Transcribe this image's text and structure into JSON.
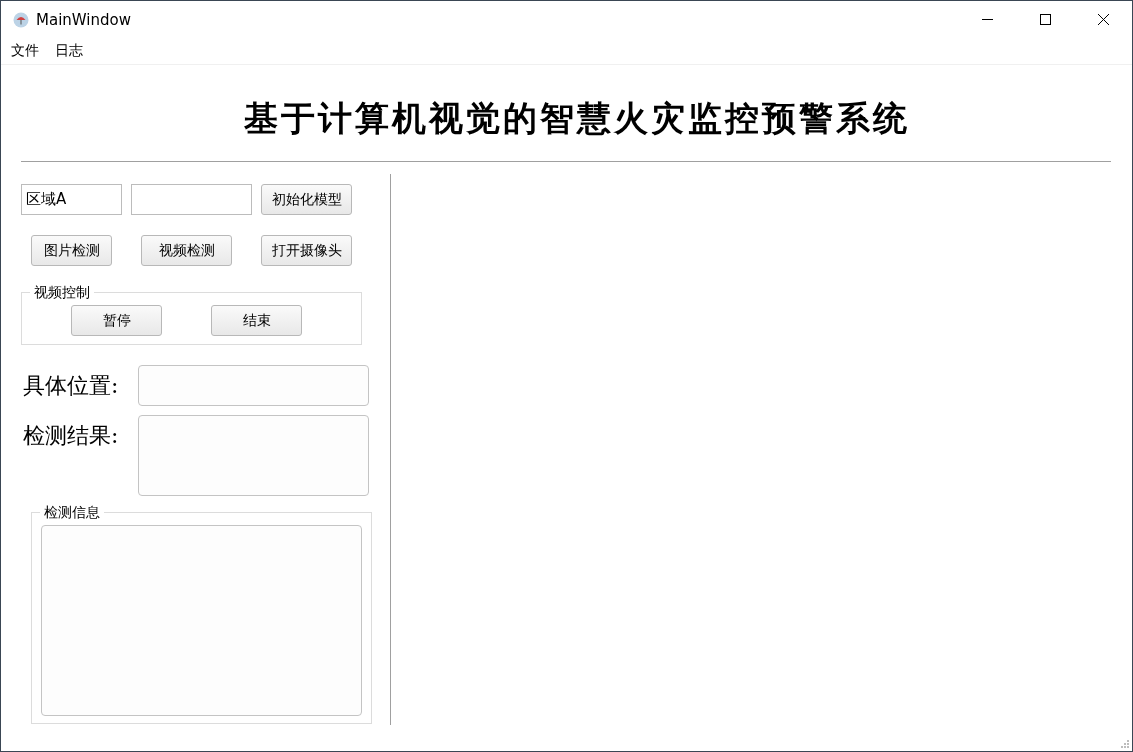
{
  "window": {
    "title": "MainWindow"
  },
  "menu": [
    "文件",
    "日志"
  ],
  "heading": "基于计算机视觉的智慧火灾监控预警系统",
  "toolbar": {
    "region_field": {
      "value": "区域A"
    },
    "init_button": "初始化模型"
  },
  "detect_buttons": [
    "图片检测",
    "视频检测",
    "打开摄像头"
  ],
  "video_control": {
    "title": "视频控制",
    "buttons": [
      "暂停",
      "结束"
    ]
  },
  "location_label": "具体位置:",
  "result_label": "检测结果:",
  "info_group": {
    "title": "检测信息"
  }
}
